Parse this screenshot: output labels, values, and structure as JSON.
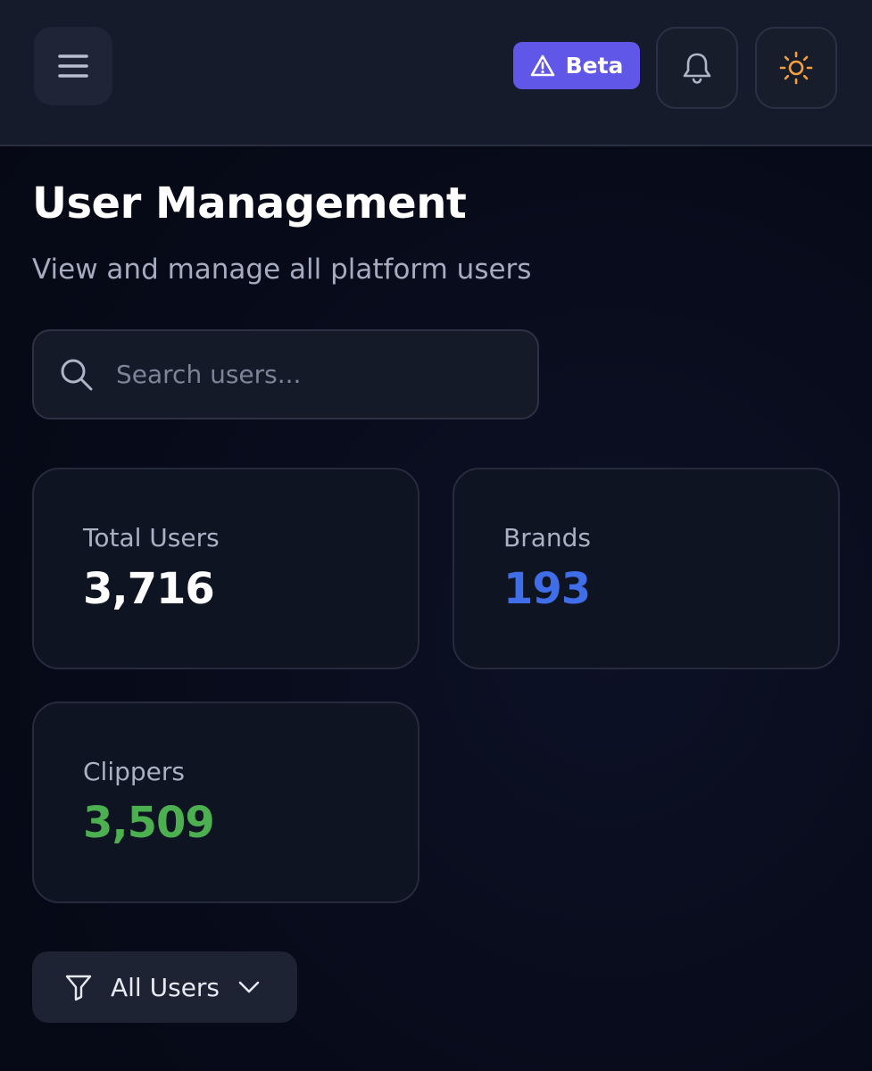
{
  "header": {
    "beta_label": "Beta",
    "icons": {
      "menu": "menu-icon",
      "beta": "alert-triangle-icon",
      "notifications": "bell-icon",
      "theme": "sun-icon"
    }
  },
  "page": {
    "title": "User Management",
    "subtitle": "View and manage all platform users"
  },
  "search": {
    "placeholder": "Search users...",
    "value": ""
  },
  "stats": [
    {
      "label": "Total Users",
      "value": "3,716",
      "color": "#ffffff"
    },
    {
      "label": "Brands",
      "value": "193",
      "color": "#3f6ee8"
    },
    {
      "label": "Clippers",
      "value": "3,509",
      "color": "#4caf50"
    }
  ],
  "filter": {
    "label": "All Users",
    "icon": "filter-icon"
  },
  "colors": {
    "accent": "#6057e8",
    "theme_icon": "#f5a13a",
    "background": "#070a18"
  }
}
